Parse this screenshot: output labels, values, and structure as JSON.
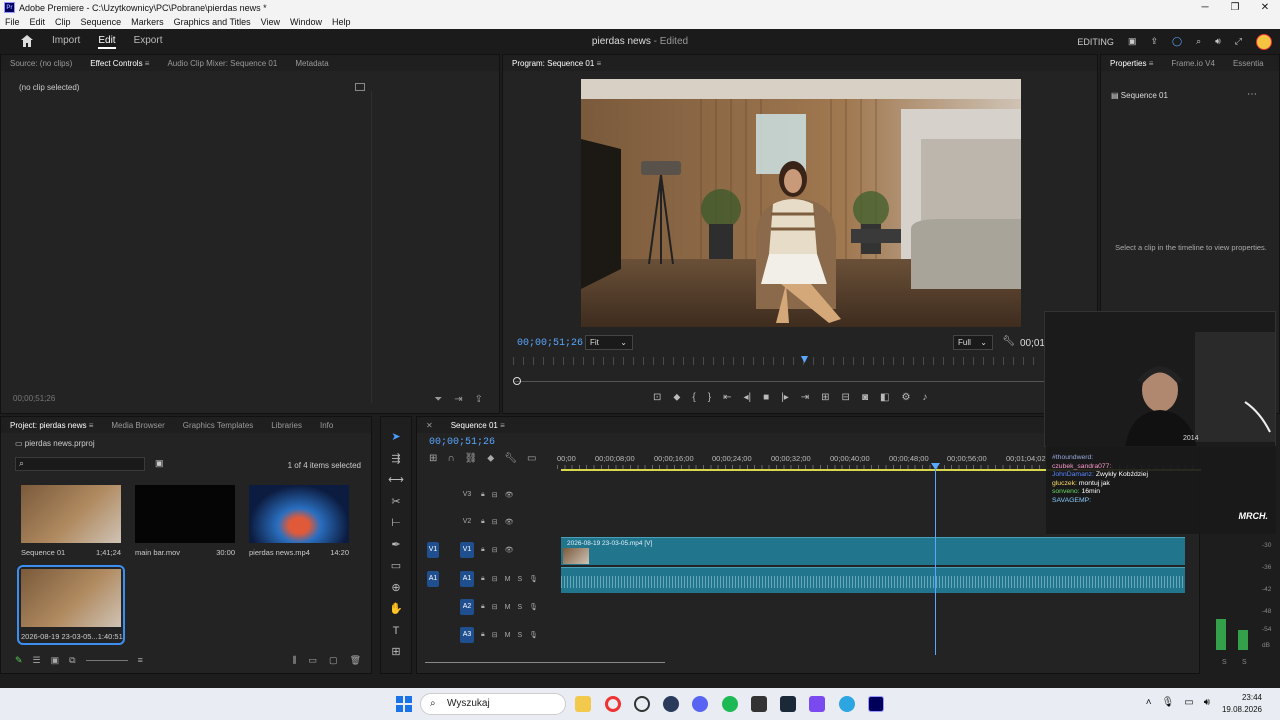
{
  "window": {
    "title": "Adobe Premiere - C:\\Uzytkownicy\\PC\\Pobrane\\pierdas news *",
    "logo": "Pr"
  },
  "menu": [
    "File",
    "Edit",
    "Clip",
    "Sequence",
    "Markers",
    "Graphics and Titles",
    "View",
    "Window",
    "Help"
  ],
  "header": {
    "tabs": [
      "Import",
      "Edit",
      "Export"
    ],
    "active_tab": "Edit",
    "project_title": "pierdas news",
    "project_status": "- Edited",
    "workspace_label": "EDITING"
  },
  "source_panel": {
    "tabs": [
      "Source: (no clips)",
      "Effect Controls",
      "Audio Clip Mixer: Sequence 01",
      "Metadata"
    ],
    "message": "(no clip selected)",
    "timecode": "00;00;51;26"
  },
  "program_panel": {
    "tab": "Program: Sequence 01",
    "timecode": "00;00;51;26",
    "fit": "Fit",
    "quality": "Full",
    "timecode_right": "00;01"
  },
  "properties_panel": {
    "tabs": [
      "Properties",
      "Frame.io V4",
      "Essentia"
    ],
    "sequence": "Sequence 01",
    "hint": "Select a clip in the timeline to view properties."
  },
  "project_panel": {
    "tabs": [
      "Project: pierdas news",
      "Media Browser",
      "Graphics Templates",
      "Libraries",
      "Info"
    ],
    "file": "pierdas news.prproj",
    "selection": "1 of 4 items selected",
    "items": [
      {
        "name": "Sequence 01",
        "duration": "1;41;24"
      },
      {
        "name": "main bar.mov",
        "duration": "30:00"
      },
      {
        "name": "pierdas news.mp4",
        "duration": "14:20"
      },
      {
        "name": "2026-08-19 23-03-05...",
        "duration": "1:40:51"
      }
    ]
  },
  "timeline": {
    "tab": "Sequence 01",
    "timecode": "00;00;51;26",
    "ruler": [
      "00;00",
      "00;00;08;00",
      "00;00;16;00",
      "00;00;24;00",
      "00;00;32;00",
      "00;00;40;00",
      "00;00;48;00",
      "00;00;56;00",
      "00;01;04;02"
    ],
    "video_tracks": [
      "V3",
      "V2",
      "V1"
    ],
    "audio_tracks": [
      "A1",
      "A2",
      "A3"
    ],
    "video_clip": "2026-08-19 23-03-05.mp4 [V]"
  },
  "chat": [
    {
      "user": "#thoundwerd:",
      "text": ""
    },
    {
      "user": "czubek_sandra077:",
      "text": ""
    },
    {
      "user": "JohnDamanz:",
      "text": "Zwykły Kobździej"
    },
    {
      "user": "gluczek:",
      "text": "montuj jak"
    },
    {
      "user": "sonveno:",
      "text": "16min"
    },
    {
      "user": "SAVAGEMP:",
      "text": ""
    }
  ],
  "chat_logo": "MRCH.",
  "meter": {
    "labels": [
      "-30",
      "-36",
      "-42",
      "-48",
      "-54",
      "dB"
    ],
    "footer": [
      "S",
      "S"
    ],
    "levels": [
      0.22,
      0.14
    ]
  },
  "taskbar": {
    "search": "Wyszukaj",
    "time": "23:44",
    "date": "19.08.2026"
  },
  "colors": {
    "accent": "#3c8ff0",
    "clip": "#21758d",
    "playhead": "#5aa7ff"
  }
}
